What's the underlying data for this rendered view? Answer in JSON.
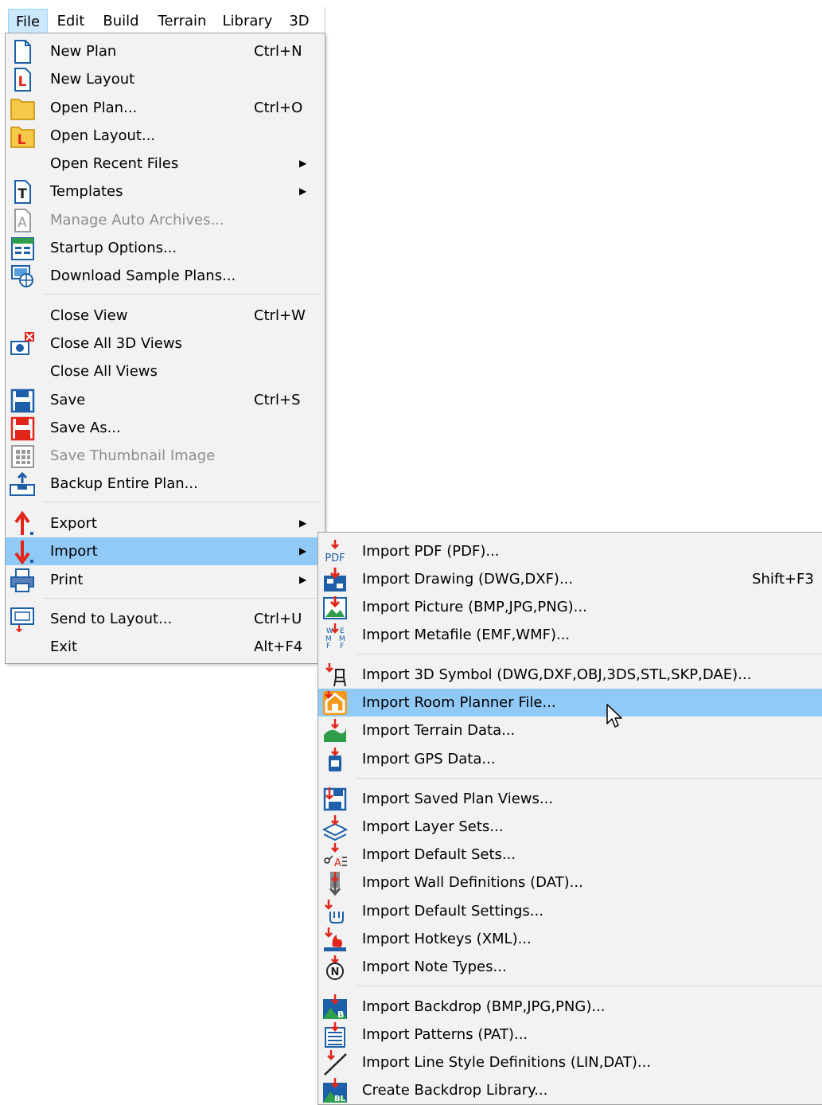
{
  "menubar": {
    "items": [
      "File",
      "Edit",
      "Build",
      "Terrain",
      "Library",
      "3D"
    ]
  },
  "file_menu": {
    "items": [
      {
        "label": "New Plan",
        "shortcut": "Ctrl+N",
        "icon": "new-plan-icon"
      },
      {
        "label": "New Layout",
        "shortcut": "",
        "icon": "new-layout-icon"
      },
      {
        "label": "Open Plan...",
        "shortcut": "Ctrl+O",
        "icon": "open-plan-icon"
      },
      {
        "label": "Open Layout...",
        "shortcut": "",
        "icon": "open-layout-icon"
      },
      {
        "label": "Open Recent Files",
        "shortcut": "",
        "icon": "",
        "submenu": true
      },
      {
        "label": "Templates",
        "shortcut": "",
        "icon": "templates-icon",
        "submenu": true
      },
      {
        "label": "Manage Auto Archives...",
        "shortcut": "",
        "icon": "auto-archive-icon",
        "disabled": true
      },
      {
        "label": "Startup Options...",
        "shortcut": "",
        "icon": "startup-options-icon"
      },
      {
        "label": "Download Sample Plans...",
        "shortcut": "",
        "icon": "download-sample-plans-icon"
      },
      {
        "label": "Close View",
        "shortcut": "Ctrl+W",
        "icon": ""
      },
      {
        "label": "Close All 3D Views",
        "shortcut": "",
        "icon": "close-3d-views-icon"
      },
      {
        "label": "Close All Views",
        "shortcut": "",
        "icon": ""
      },
      {
        "label": "Save",
        "shortcut": "Ctrl+S",
        "icon": "save-icon"
      },
      {
        "label": "Save As...",
        "shortcut": "",
        "icon": "save-as-icon"
      },
      {
        "label": "Save Thumbnail Image",
        "shortcut": "",
        "icon": "thumbnail-icon",
        "disabled": true
      },
      {
        "label": "Backup Entire Plan...",
        "shortcut": "",
        "icon": "backup-icon"
      },
      {
        "label": "Export",
        "shortcut": "",
        "icon": "export-icon",
        "submenu": true
      },
      {
        "label": "Import",
        "shortcut": "",
        "icon": "import-icon",
        "submenu": true,
        "highlighted": true
      },
      {
        "label": "Print",
        "shortcut": "",
        "icon": "print-icon",
        "submenu": true
      },
      {
        "label": "Send to Layout...",
        "shortcut": "Ctrl+U",
        "icon": "send-to-layout-icon"
      },
      {
        "label": "Exit",
        "shortcut": "Alt+F4",
        "icon": ""
      }
    ]
  },
  "import_menu": {
    "items": [
      {
        "label": "Import PDF (PDF)...",
        "shortcut": "",
        "icon": "import-pdf-icon"
      },
      {
        "label": "Import Drawing (DWG,DXF)...",
        "shortcut": "Shift+F3",
        "icon": "import-drawing-icon"
      },
      {
        "label": "Import Picture (BMP,JPG,PNG)...",
        "shortcut": "",
        "icon": "import-picture-icon"
      },
      {
        "label": "Import Metafile (EMF,WMF)...",
        "shortcut": "",
        "icon": "import-metafile-icon"
      },
      {
        "label": "Import 3D Symbol (DWG,DXF,OBJ,3DS,STL,SKP,DAE)...",
        "shortcut": "",
        "icon": "import-3d-symbol-icon"
      },
      {
        "label": "Import Room Planner File...",
        "shortcut": "",
        "icon": "room-planner-icon",
        "highlighted": true
      },
      {
        "label": "Import Terrain Data...",
        "shortcut": "",
        "icon": "terrain-data-icon"
      },
      {
        "label": "Import GPS Data...",
        "shortcut": "",
        "icon": "gps-data-icon"
      },
      {
        "label": "Import Saved Plan Views...",
        "shortcut": "",
        "icon": "saved-plan-views-icon"
      },
      {
        "label": "Import Layer Sets...",
        "shortcut": "",
        "icon": "layer-sets-icon"
      },
      {
        "label": "Import Default Sets...",
        "shortcut": "",
        "icon": "default-sets-icon"
      },
      {
        "label": "Import Wall Definitions (DAT)...",
        "shortcut": "",
        "icon": "wall-definitions-icon"
      },
      {
        "label": "Import Default Settings...",
        "shortcut": "",
        "icon": "default-settings-icon"
      },
      {
        "label": "Import Hotkeys (XML)...",
        "shortcut": "",
        "icon": "hotkeys-icon"
      },
      {
        "label": "Import Note Types...",
        "shortcut": "",
        "icon": "note-types-icon"
      },
      {
        "label": "Import Backdrop (BMP,JPG,PNG)...",
        "shortcut": "",
        "icon": "backdrop-icon"
      },
      {
        "label": "Import Patterns (PAT)...",
        "shortcut": "",
        "icon": "patterns-icon"
      },
      {
        "label": "Import Line Style Definitions (LIN,DAT)...",
        "shortcut": "",
        "icon": "line-style-icon"
      },
      {
        "label": "Create Backdrop Library...",
        "shortcut": "",
        "icon": "backdrop-library-icon"
      }
    ]
  },
  "icon_text": {
    "pdf": "PDF",
    "layout_l": "L",
    "templates_t": "T",
    "archive_a": "A",
    "note_n": "N",
    "backdrop_b": "B",
    "backdrop_lib_bl": "BL",
    "metafile_w": "W",
    "metafile_e": "E",
    "metafile_m": "M",
    "metafile_f": "F"
  },
  "colors": {
    "menu_bg": "#f2f2f2",
    "highlight": "#91c9f7",
    "menubar_open_bg": "#cce8ff",
    "disabled_text": "#8d8d8d",
    "import_arrow": "#e1251b",
    "icon_blue": "#1d5fa8",
    "folder_orange": "#f0b400"
  }
}
